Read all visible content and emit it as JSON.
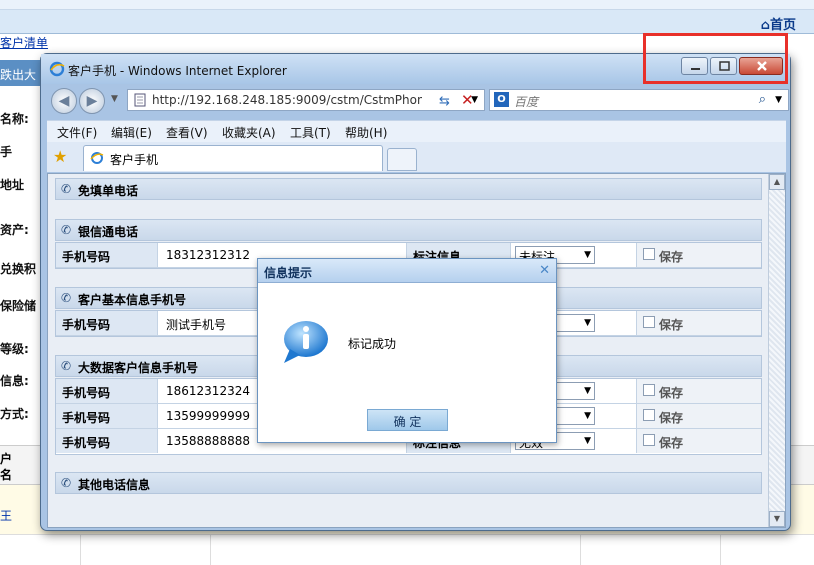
{
  "background": {
    "home_link": "首页",
    "breadcrumb": "客户清单",
    "strip_text": "跌出大",
    "labels": [
      "名称:",
      "手",
      "地址",
      "资产:",
      "兑换积",
      "保险储",
      "等级:",
      "信息:",
      "方式:"
    ],
    "table_head_fragments": [
      "户",
      "名"
    ],
    "row_fragment": "王"
  },
  "highlight": {
    "color": "#e8302a"
  },
  "window": {
    "title": "客户手机 - Windows Internet Explorer",
    "icon": "ie-logo-icon"
  },
  "address": {
    "url": "http://192.168.248.185:9009/cstm/CstmPhon",
    "search_placeholder": "百度"
  },
  "menu": [
    "文件(F)",
    "编辑(E)",
    "查看(V)",
    "收藏夹(A)",
    "工具(T)",
    "帮助(H)"
  ],
  "tab": {
    "label": "客户手机"
  },
  "sections": {
    "free": "免填单电话",
    "yinxin": "银信通电话",
    "basic": "客户基本信息手机号",
    "bigdata": "大数据客户信息手机号",
    "other": "其他电话信息"
  },
  "yinxin_rows": [
    {
      "label": "手机号码",
      "phone": "18312312312",
      "mark_label": "标注信息",
      "mark": "未标注",
      "save": "保存"
    }
  ],
  "basic_rows": [
    {
      "label": "手机号码",
      "phone": "测试手机号",
      "mark_label": "",
      "mark": "",
      "save": "保存"
    }
  ],
  "bigdata_rows": [
    {
      "label": "手机号码",
      "phone": "18612312324",
      "mark_label": "",
      "mark": "",
      "save": "保存"
    },
    {
      "label": "手机号码",
      "phone": "13599999999",
      "mark_label": "",
      "mark": "",
      "save": "保存"
    },
    {
      "label": "手机号码",
      "phone": "13588888888",
      "mark_label": "标注信息",
      "mark": "无效",
      "save": "保存"
    }
  ],
  "dialog": {
    "title": "信息提示",
    "message": "标记成功",
    "ok": "确 定"
  }
}
